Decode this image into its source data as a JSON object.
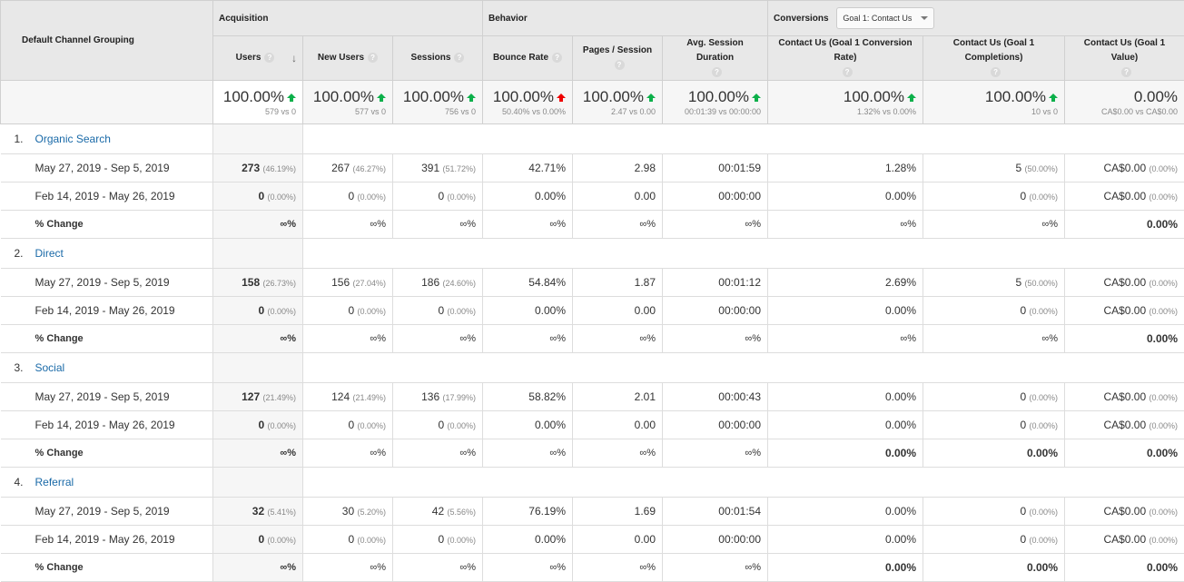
{
  "header": {
    "dimension": "Default Channel Grouping",
    "groups": {
      "acquisition": "Acquisition",
      "behavior": "Behavior",
      "conversions": "Conversions"
    },
    "goal_select": {
      "value": "Goal 1: Contact Us"
    },
    "help_glyph": "?",
    "sort_glyph": "↓",
    "columns": [
      "Users",
      "New Users",
      "Sessions",
      "Bounce Rate",
      "Pages / Session",
      "Avg. Session Duration",
      "Contact Us (Goal 1 Conversion Rate)",
      "Contact Us (Goal 1 Completions)",
      "Contact Us (Goal 1 Value)"
    ],
    "sorted_column": "Users"
  },
  "summary": [
    {
      "change": "100.00%",
      "detail": "579 vs 0",
      "arrow": "up-green"
    },
    {
      "change": "100.00%",
      "detail": "577 vs 0",
      "arrow": "up-green"
    },
    {
      "change": "100.00%",
      "detail": "756 vs 0",
      "arrow": "up-green"
    },
    {
      "change": "100.00%",
      "detail": "50.40% vs 0.00%",
      "arrow": "up-red"
    },
    {
      "change": "100.00%",
      "detail": "2.47 vs 0.00",
      "arrow": "up-green"
    },
    {
      "change": "100.00%",
      "detail": "00:01:39 vs 00:00:00",
      "arrow": "up-green"
    },
    {
      "change": "100.00%",
      "detail": "1.32% vs 0.00%",
      "arrow": "up-green"
    },
    {
      "change": "100.00%",
      "detail": "10 vs 0",
      "arrow": "up-green"
    },
    {
      "change": "0.00%",
      "detail": "CA$0.00 vs CA$0.00",
      "arrow": ""
    }
  ],
  "colors": {
    "link": "#1a6aa8",
    "up_good": "#0cb04a",
    "up_bad": "#ee0000"
  },
  "channels": [
    {
      "index": "1.",
      "name": "Organic Search",
      "rows": [
        {
          "label": "May 27, 2019 - Sep 5, 2019",
          "cells": [
            [
              "273",
              "(46.19%)"
            ],
            [
              "267",
              "(46.27%)"
            ],
            [
              "391",
              "(51.72%)"
            ],
            [
              "42.71%",
              ""
            ],
            [
              "2.98",
              ""
            ],
            [
              "00:01:59",
              ""
            ],
            [
              "1.28%",
              ""
            ],
            [
              "5",
              "(50.00%)"
            ],
            [
              "CA$0.00",
              "(0.00%)"
            ]
          ]
        },
        {
          "label": "Feb 14, 2019 - May 26, 2019",
          "cells": [
            [
              "0",
              "(0.00%)"
            ],
            [
              "0",
              "(0.00%)"
            ],
            [
              "0",
              "(0.00%)"
            ],
            [
              "0.00%",
              ""
            ],
            [
              "0.00",
              ""
            ],
            [
              "00:00:00",
              ""
            ],
            [
              "0.00%",
              ""
            ],
            [
              "0",
              "(0.00%)"
            ],
            [
              "CA$0.00",
              "(0.00%)"
            ]
          ]
        },
        {
          "label": "% Change",
          "cells": [
            [
              "∞%",
              ""
            ],
            [
              "∞%",
              ""
            ],
            [
              "∞%",
              ""
            ],
            [
              "∞%",
              ""
            ],
            [
              "∞%",
              ""
            ],
            [
              "∞%",
              ""
            ],
            [
              "∞%",
              ""
            ],
            [
              "∞%",
              ""
            ],
            [
              "0.00%",
              ""
            ]
          ]
        }
      ]
    },
    {
      "index": "2.",
      "name": "Direct",
      "rows": [
        {
          "label": "May 27, 2019 - Sep 5, 2019",
          "cells": [
            [
              "158",
              "(26.73%)"
            ],
            [
              "156",
              "(27.04%)"
            ],
            [
              "186",
              "(24.60%)"
            ],
            [
              "54.84%",
              ""
            ],
            [
              "1.87",
              ""
            ],
            [
              "00:01:12",
              ""
            ],
            [
              "2.69%",
              ""
            ],
            [
              "5",
              "(50.00%)"
            ],
            [
              "CA$0.00",
              "(0.00%)"
            ]
          ]
        },
        {
          "label": "Feb 14, 2019 - May 26, 2019",
          "cells": [
            [
              "0",
              "(0.00%)"
            ],
            [
              "0",
              "(0.00%)"
            ],
            [
              "0",
              "(0.00%)"
            ],
            [
              "0.00%",
              ""
            ],
            [
              "0.00",
              ""
            ],
            [
              "00:00:00",
              ""
            ],
            [
              "0.00%",
              ""
            ],
            [
              "0",
              "(0.00%)"
            ],
            [
              "CA$0.00",
              "(0.00%)"
            ]
          ]
        },
        {
          "label": "% Change",
          "cells": [
            [
              "∞%",
              ""
            ],
            [
              "∞%",
              ""
            ],
            [
              "∞%",
              ""
            ],
            [
              "∞%",
              ""
            ],
            [
              "∞%",
              ""
            ],
            [
              "∞%",
              ""
            ],
            [
              "∞%",
              ""
            ],
            [
              "∞%",
              ""
            ],
            [
              "0.00%",
              ""
            ]
          ]
        }
      ]
    },
    {
      "index": "3.",
      "name": "Social",
      "rows": [
        {
          "label": "May 27, 2019 - Sep 5, 2019",
          "cells": [
            [
              "127",
              "(21.49%)"
            ],
            [
              "124",
              "(21.49%)"
            ],
            [
              "136",
              "(17.99%)"
            ],
            [
              "58.82%",
              ""
            ],
            [
              "2.01",
              ""
            ],
            [
              "00:00:43",
              ""
            ],
            [
              "0.00%",
              ""
            ],
            [
              "0",
              "(0.00%)"
            ],
            [
              "CA$0.00",
              "(0.00%)"
            ]
          ]
        },
        {
          "label": "Feb 14, 2019 - May 26, 2019",
          "cells": [
            [
              "0",
              "(0.00%)"
            ],
            [
              "0",
              "(0.00%)"
            ],
            [
              "0",
              "(0.00%)"
            ],
            [
              "0.00%",
              ""
            ],
            [
              "0.00",
              ""
            ],
            [
              "00:00:00",
              ""
            ],
            [
              "0.00%",
              ""
            ],
            [
              "0",
              "(0.00%)"
            ],
            [
              "CA$0.00",
              "(0.00%)"
            ]
          ]
        },
        {
          "label": "% Change",
          "cells": [
            [
              "∞%",
              ""
            ],
            [
              "∞%",
              ""
            ],
            [
              "∞%",
              ""
            ],
            [
              "∞%",
              ""
            ],
            [
              "∞%",
              ""
            ],
            [
              "∞%",
              ""
            ],
            [
              "0.00%",
              ""
            ],
            [
              "0.00%",
              ""
            ],
            [
              "0.00%",
              ""
            ]
          ]
        }
      ]
    },
    {
      "index": "4.",
      "name": "Referral",
      "rows": [
        {
          "label": "May 27, 2019 - Sep 5, 2019",
          "cells": [
            [
              "32",
              "(5.41%)"
            ],
            [
              "30",
              "(5.20%)"
            ],
            [
              "42",
              "(5.56%)"
            ],
            [
              "76.19%",
              ""
            ],
            [
              "1.69",
              ""
            ],
            [
              "00:01:54",
              ""
            ],
            [
              "0.00%",
              ""
            ],
            [
              "0",
              "(0.00%)"
            ],
            [
              "CA$0.00",
              "(0.00%)"
            ]
          ]
        },
        {
          "label": "Feb 14, 2019 - May 26, 2019",
          "cells": [
            [
              "0",
              "(0.00%)"
            ],
            [
              "0",
              "(0.00%)"
            ],
            [
              "0",
              "(0.00%)"
            ],
            [
              "0.00%",
              ""
            ],
            [
              "0.00",
              ""
            ],
            [
              "00:00:00",
              ""
            ],
            [
              "0.00%",
              ""
            ],
            [
              "0",
              "(0.00%)"
            ],
            [
              "CA$0.00",
              "(0.00%)"
            ]
          ]
        },
        {
          "label": "% Change",
          "cells": [
            [
              "∞%",
              ""
            ],
            [
              "∞%",
              ""
            ],
            [
              "∞%",
              ""
            ],
            [
              "∞%",
              ""
            ],
            [
              "∞%",
              ""
            ],
            [
              "∞%",
              ""
            ],
            [
              "0.00%",
              ""
            ],
            [
              "0.00%",
              ""
            ],
            [
              "0.00%",
              ""
            ]
          ]
        }
      ]
    }
  ]
}
